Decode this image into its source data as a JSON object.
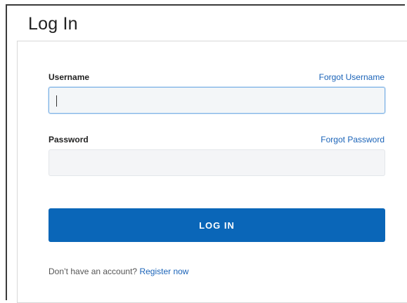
{
  "page": {
    "title": "Log In"
  },
  "form": {
    "username_label": "Username",
    "forgot_username": "Forgot Username",
    "username_value": "",
    "password_label": "Password",
    "forgot_password": "Forgot Password",
    "password_value": "",
    "login_button": "LOG IN"
  },
  "footer": {
    "prompt": "Don’t have an account?",
    "register_link": "Register now"
  },
  "colors": {
    "primary": "#0a66b8",
    "link": "#1a63b8",
    "input_bg": "#f4f5f7",
    "focus_border": "#7fb3e6"
  }
}
